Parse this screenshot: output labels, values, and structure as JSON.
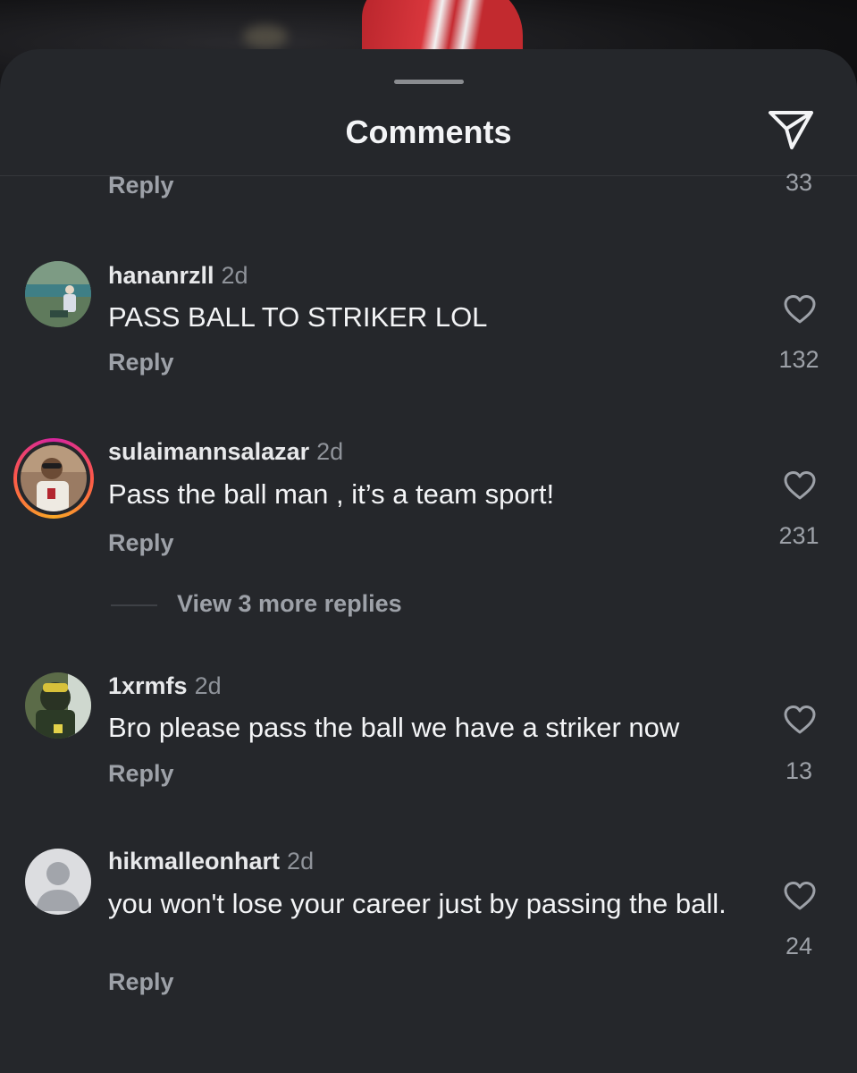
{
  "header": {
    "title": "Comments"
  },
  "previous": {
    "reply_label": "Reply",
    "like_count": "33"
  },
  "comments": [
    {
      "username": "hananrzll",
      "time": "2d",
      "text": "PASS BALL TO STRIKER LOL",
      "reply_label": "Reply",
      "like_count": "132"
    },
    {
      "username": "sulaimannsalazar",
      "time": "2d",
      "text": "Pass the ball man , it’s a team sport!",
      "reply_label": "Reply",
      "like_count": "231",
      "view_more_replies": "View 3 more replies"
    },
    {
      "username": "1xrmfs",
      "time": "2d",
      "text": "Bro please pass the ball we have a striker now",
      "reply_label": "Reply",
      "like_count": "13"
    },
    {
      "username": "hikmalleonhart",
      "time": "2d",
      "text": "you won't lose your career just by passing the ball.",
      "reply_label": "Reply",
      "like_count": "24"
    }
  ],
  "icons": {
    "send": "send-icon",
    "like": "heart-icon",
    "default_avatar": "person-icon"
  },
  "colors": {
    "sheet_background": "#25272b",
    "primary_text": "#f3f4f6",
    "secondary_text": "#9da1a8",
    "story_ring_start": "#f9a825",
    "story_ring_end": "#d6249f"
  }
}
